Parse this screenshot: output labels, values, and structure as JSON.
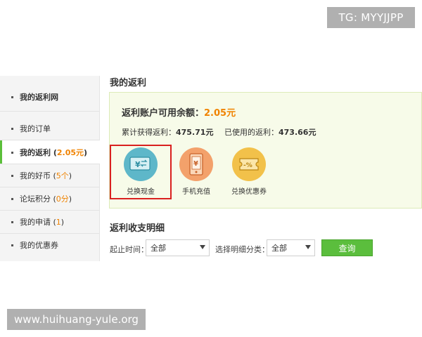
{
  "watermarks": {
    "top": "TG: MYYJJPP",
    "bottom": "www.huihuang-yule.org"
  },
  "sidebar": {
    "items": [
      {
        "label": "我的返利网",
        "extra": ""
      },
      {
        "label": "我的订单",
        "extra": ""
      },
      {
        "label": "我的返利 (",
        "extra": "2.05元",
        "suffix": ")"
      },
      {
        "label": "我的好币 (",
        "extra": "5个",
        "suffix": ")"
      },
      {
        "label": "论坛积分 (",
        "extra": "0分",
        "suffix": ")"
      },
      {
        "label": "我的申请 (",
        "extra": "1",
        "suffix": ")"
      },
      {
        "label": "我的优惠券",
        "extra": ""
      }
    ]
  },
  "main": {
    "title": "我的返利",
    "balance_label": "返利账户可用余额：",
    "balance_amount": "2.05元",
    "earned_label": "累计获得返利：",
    "earned_value": "475.71元",
    "used_label": "已使用的返利：",
    "used_value": "473.66元",
    "actions": [
      {
        "label": "兑换现金",
        "icon": "cash-exchange-icon",
        "color": "#5eb7c9"
      },
      {
        "label": "手机充值",
        "icon": "phone-recharge-icon",
        "color": "#f3a16b"
      },
      {
        "label": "兑换优惠券",
        "icon": "coupon-exchange-icon",
        "color": "#f2c14a"
      }
    ]
  },
  "details": {
    "title": "返利收支明细",
    "date_label": "起止时间：",
    "date_value": "全部",
    "category_label": "选择明细分类：",
    "category_value": "全部",
    "query_label": "查询"
  },
  "colors": {
    "accent": "#5bbe3d",
    "highlight": "#f08300",
    "annotation": "#d9201f"
  }
}
